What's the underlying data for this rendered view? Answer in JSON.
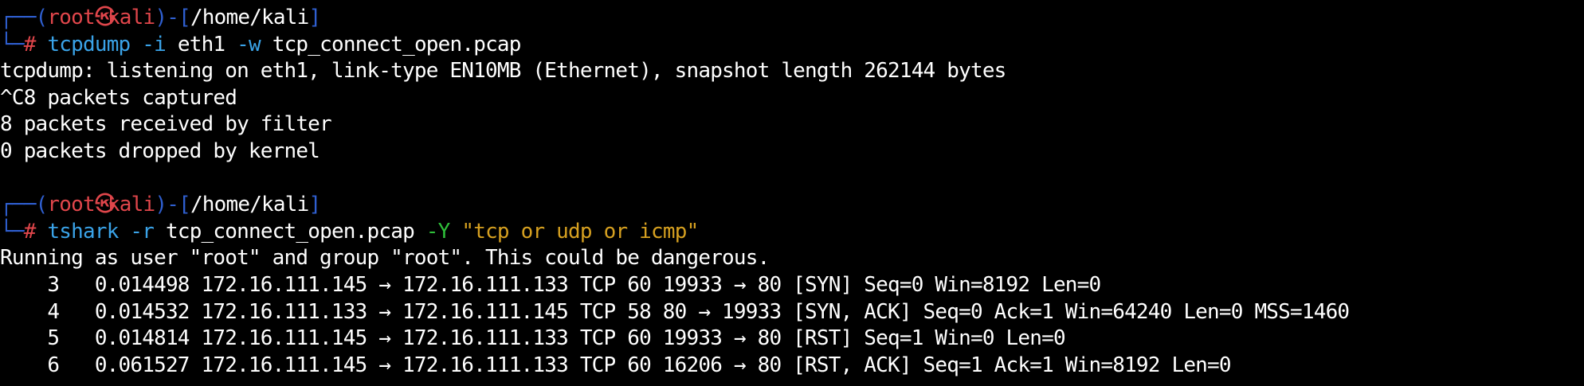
{
  "colors": {
    "background": "#000000",
    "frame": "#2f5fd0",
    "user": "#e0464b",
    "command": "#3aa3e8",
    "flag": "#2fbf3a",
    "string": "#d6a020",
    "output": "#ffffff"
  },
  "prompt": {
    "top_left": "┌──(",
    "user": "root",
    "symbol": "㉿",
    "host": "kali",
    "close_paren": ")-[",
    "path": "/home/kali",
    "close_bracket": "]",
    "bottom_left": "└─",
    "hash": "#"
  },
  "session1": {
    "cmd": "tcpdump",
    "opt_i": "-i",
    "iface": "eth1",
    "opt_w": "-w",
    "file": "tcp_connect_open.pcap",
    "output": [
      "tcpdump: listening on eth1, link-type EN10MB (Ethernet), snapshot length 262144 bytes",
      "^C8 packets captured",
      "8 packets received by filter",
      "0 packets dropped by kernel"
    ]
  },
  "session2": {
    "cmd": "tshark",
    "opt_r": "-r",
    "file": "tcp_connect_open.pcap",
    "opt_Y": "-Y",
    "filter": "\"tcp or udp or icmp\"",
    "warning": "Running as user \"root\" and group \"root\". This could be dangerous.",
    "packets": [
      "    3   0.014498 172.16.111.145 → 172.16.111.133 TCP 60 19933 → 80 [SYN] Seq=0 Win=8192 Len=0",
      "    4   0.014532 172.16.111.133 → 172.16.111.145 TCP 58 80 → 19933 [SYN, ACK] Seq=0 Ack=1 Win=64240 Len=0 MSS=1460",
      "    5   0.014814 172.16.111.145 → 172.16.111.133 TCP 60 19933 → 80 [RST] Seq=1 Win=0 Len=0",
      "    6   0.061527 172.16.111.145 → 172.16.111.133 TCP 60 16206 → 80 [RST, ACK] Seq=1 Ack=1 Win=8192 Len=0"
    ]
  }
}
